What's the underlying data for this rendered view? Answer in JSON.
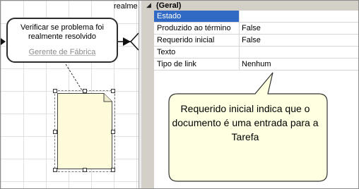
{
  "diagram": {
    "lane_label": "realme",
    "task": {
      "title": "Verificar se problema foi realmente resolvido",
      "role": "Gerente de Fábrica"
    }
  },
  "properties": {
    "category": {
      "label": "(Geral)",
      "expanded": true
    },
    "rows": [
      {
        "name": "Estado",
        "value": "",
        "selected": true
      },
      {
        "name": "Produzido ao término",
        "value": "False"
      },
      {
        "name": "Requerido inicial",
        "value": "False"
      },
      {
        "name": "Texto",
        "value": ""
      },
      {
        "name": "Tipo de link",
        "value": "Nenhum"
      }
    ],
    "selected_color": "#316ac5"
  },
  "callout": {
    "text": "Requerido inicial indica que o documento é uma entrada para a Tarefa",
    "fill": "#ffffe1"
  }
}
